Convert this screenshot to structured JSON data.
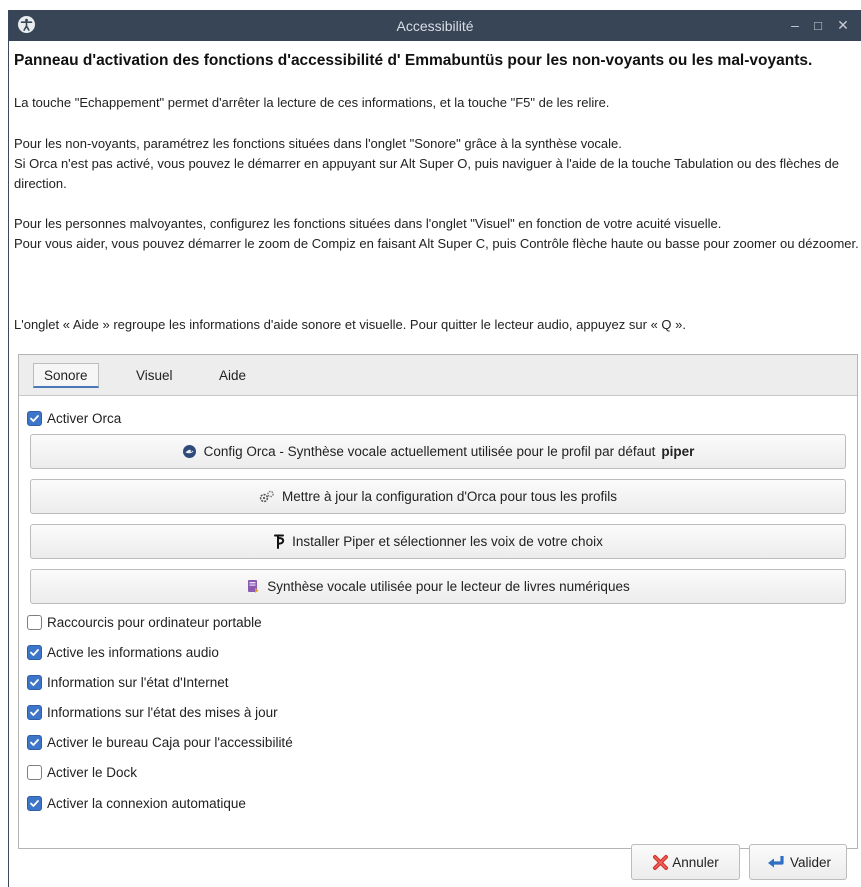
{
  "window": {
    "title": "Accessibilité",
    "minimize": "–",
    "maximize": "□",
    "close": "✕"
  },
  "intro": {
    "heading": "Panneau d'activation des fonctions d'accessibilité d' Emmabuntüs pour les non-voyants ou les mal-voyants.",
    "p1": "La touche \"Echappement\" permet d'arrêter la lecture de ces informations, et la touche \"F5\" de les relire.",
    "p2": "Pour les non-voyants, paramétrez les fonctions situées dans l'onglet \"Sonore\" grâce à la synthèse vocale.\nSi Orca n'est pas activé, vous pouvez le démarrer en appuyant sur Alt Super O, puis naviguer à l'aide de la touche Tabulation ou des flèches de direction.",
    "p3": "Pour les personnes malvoyantes, configurez les fonctions situées dans l'onglet \"Visuel\" en fonction de votre acuité visuelle.\nPour vous aider, vous pouvez démarrer le zoom de Compiz en faisant Alt Super C, puis Contrôle flèche haute ou basse pour zoomer ou dézoomer.",
    "p4": "L'onglet « Aide » regroupe les informations d'aide sonore et visuelle. Pour quitter le lecteur audio, appuyez sur « Q »."
  },
  "tabs": [
    {
      "label": "Sonore",
      "active": true
    },
    {
      "label": "Visuel",
      "active": false
    },
    {
      "label": "Aide",
      "active": false
    }
  ],
  "sonore": {
    "activer_orca": {
      "label": "Activer Orca",
      "checked": true
    },
    "buttons": {
      "config_orca": {
        "label": "Config Orca  - Synthèse vocale actuellement utilisée pour le profil par défaut",
        "bold": "piper",
        "icon": "orca-icon"
      },
      "update_profiles": {
        "label": "Mettre à jour la configuration d'Orca pour tous les profils",
        "icon": "settings-gears-icon"
      },
      "install_piper": {
        "label": "Installer Piper et sélectionner les voix de votre choix",
        "icon": "piper-icon"
      },
      "ebook_voice": {
        "label": "Synthèse vocale utilisée pour le lecteur de livres numériques",
        "icon": "ebook-reader-icon"
      }
    },
    "options": [
      {
        "label": "Raccourcis pour ordinateur portable",
        "checked": false
      },
      {
        "label": "Active les informations audio",
        "checked": true
      },
      {
        "label": "Information sur l'état d'Internet",
        "checked": true
      },
      {
        "label": "Informations sur l'état des mises à jour",
        "checked": true
      },
      {
        "label": "Activer le bureau Caja pour l'accessibilité",
        "checked": true
      },
      {
        "label": "Activer le Dock",
        "checked": false
      },
      {
        "label": "Activer la connexion automatique",
        "checked": true
      }
    ]
  },
  "footer": {
    "cancel": {
      "label": "Annuler",
      "icon": "red-x-icon"
    },
    "ok": {
      "label": "Valider",
      "icon": "enter-arrow-icon"
    }
  },
  "colors": {
    "titlebar": "#384557",
    "checkbox_checked": "#3d75c8",
    "tab_underline": "#4a78b8"
  }
}
